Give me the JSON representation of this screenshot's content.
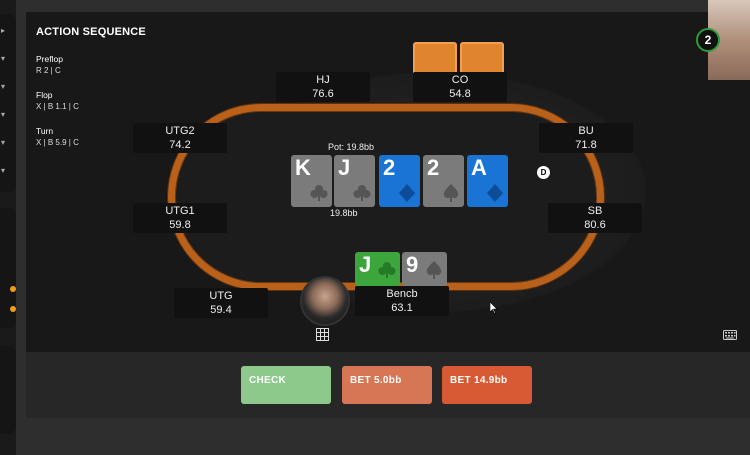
{
  "action_sequence": {
    "title": "ACTION SEQUENCE",
    "streets": [
      {
        "name": "Preflop",
        "actions": "R 2 | C"
      },
      {
        "name": "Flop",
        "actions": "X | B 1.1 | C"
      },
      {
        "name": "Turn",
        "actions": "X | B 5.9 | C"
      }
    ]
  },
  "seats": {
    "hj": {
      "name": "HJ",
      "stack": "76.6"
    },
    "co": {
      "name": "CO",
      "stack": "54.8"
    },
    "utg2": {
      "name": "UTG2",
      "stack": "74.2"
    },
    "bu": {
      "name": "BU",
      "stack": "71.8"
    },
    "utg1": {
      "name": "UTG1",
      "stack": "59.8"
    },
    "sb": {
      "name": "SB",
      "stack": "80.6"
    },
    "utg": {
      "name": "UTG",
      "stack": "59.4"
    },
    "hero": {
      "name": "Bencb",
      "stack": "63.1"
    }
  },
  "pot": {
    "label": "Pot: 19.8bb",
    "bottom_label": "19.8bb"
  },
  "board": [
    {
      "rank": "K",
      "suit": "club",
      "color": "gray"
    },
    {
      "rank": "J",
      "suit": "club",
      "color": "gray"
    },
    {
      "rank": "2",
      "suit": "diamond",
      "color": "blue"
    },
    {
      "rank": "2",
      "suit": "spade",
      "color": "gray"
    },
    {
      "rank": "A",
      "suit": "diamond",
      "color": "blue"
    }
  ],
  "hero_cards": [
    {
      "rank": "J",
      "suit": "club",
      "color": "green"
    },
    {
      "rank": "9",
      "suit": "spade",
      "color": "gray"
    }
  ],
  "dealer_button": "D",
  "timer": "2",
  "actions": {
    "check": "CHECK",
    "bet_small": "BET 5.0bb",
    "bet_large": "BET 14.9bb"
  },
  "colors": {
    "felt_rail": "#b9601a",
    "check": "#8cc98a",
    "bet_small": "#d67654",
    "bet_large": "#d85a34",
    "card_blue": "#1a74d6",
    "card_gray": "#7b7b7b",
    "card_green": "#3ca53c"
  }
}
